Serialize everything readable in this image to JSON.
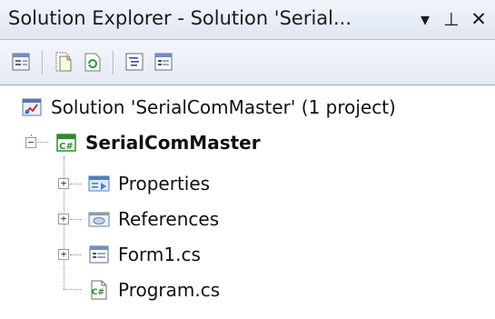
{
  "window": {
    "title": "Solution Explorer - Solution 'Serial...",
    "dropdown_glyph": "▾",
    "pin_glyph": "⊥",
    "close_glyph": "✕"
  },
  "toolbar": {
    "buttons": [
      {
        "icon": "properties-window-icon"
      },
      {
        "icon": "show-all-files-icon"
      },
      {
        "icon": "refresh-icon"
      },
      {
        "icon": "view-code-icon"
      },
      {
        "icon": "view-designer-icon"
      }
    ]
  },
  "tree": {
    "solution_label": "Solution 'SerialComMaster' (1 project)",
    "project_label": "SerialComMaster",
    "items": [
      {
        "label": "Properties",
        "icon": "properties-folder-icon",
        "expandable": true
      },
      {
        "label": "References",
        "icon": "references-icon",
        "expandable": true
      },
      {
        "label": "Form1.cs",
        "icon": "form-icon",
        "expandable": true
      },
      {
        "label": "Program.cs",
        "icon": "csharp-file-icon",
        "expandable": false
      }
    ],
    "expand_glyph": "+",
    "collapse_glyph": "−"
  },
  "colors": {
    "csharp_green": "#2e8b2e",
    "folder_blue": "#4f7fc4"
  }
}
